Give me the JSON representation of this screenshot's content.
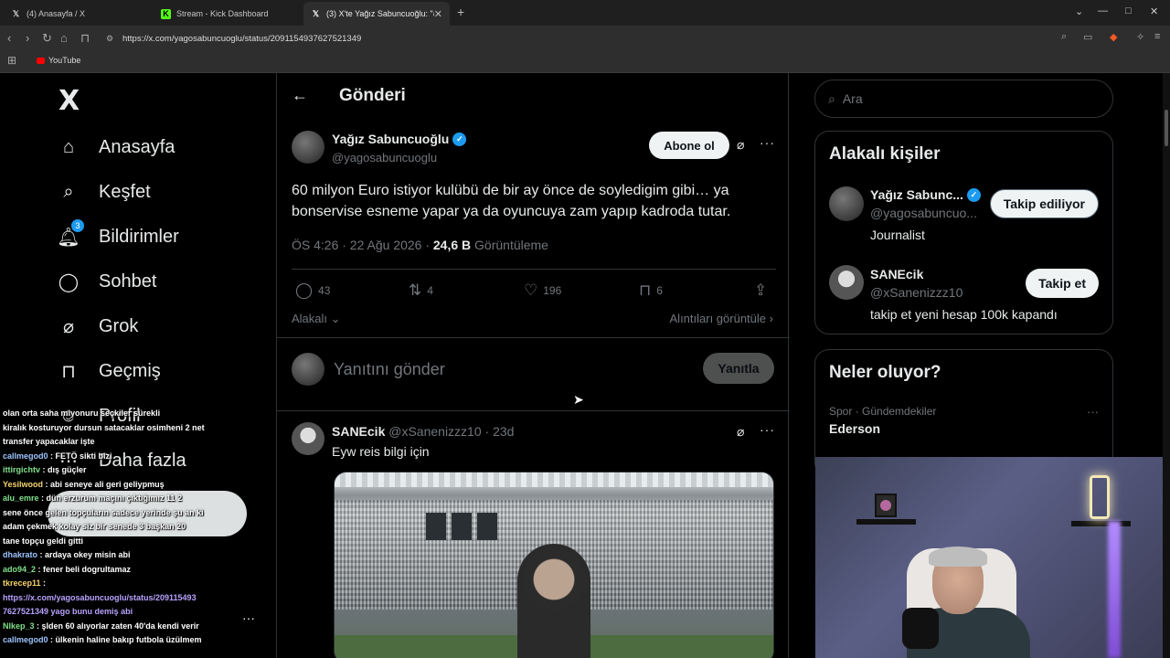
{
  "browser": {
    "tabs": [
      {
        "label": "(4) Anasayfa / X",
        "icon": "x-logo"
      },
      {
        "label": "Stream - Kick Dashboard",
        "icon": "kick-logo"
      },
      {
        "label": "(3) X'te Yağız Sabuncuoğlu: \"@x…",
        "icon": "x-logo"
      }
    ],
    "url": "https://x.com/yagosabuncuoglu/status/2091154937627521349",
    "bookmark": "YouTube"
  },
  "nav": {
    "logo": "X",
    "items": [
      {
        "label": "Anasayfa",
        "icon": "home-icon"
      },
      {
        "label": "Keşfet",
        "icon": "search-icon"
      },
      {
        "label": "Bildirimler",
        "icon": "bell-icon",
        "badge": "3"
      },
      {
        "label": "Sohbet",
        "icon": "chat-icon"
      },
      {
        "label": "Grok",
        "icon": "grok-icon"
      },
      {
        "label": "Geçmiş",
        "icon": "bookmark-icon"
      },
      {
        "label": "Profil",
        "icon": "profile-icon"
      },
      {
        "label": "Daha fazla",
        "icon": "more-icon"
      }
    ]
  },
  "header": {
    "title": "Gönderi"
  },
  "post": {
    "author": "Yağız Sabuncuoğlu",
    "handle": "@yagosabuncuoglu",
    "subscribe": "Abone ol",
    "text": "60 milyon Euro istiyor kulübü de bir ay önce de soyledigim gibi… ya bonservise esneme yapar ya da oyuncuya zam yapıp kadroda tutar.",
    "time": "ÖS 4:26 · 22 Ağu 2026 · ",
    "views": "24,6 B",
    "views_label": " Görüntüleme",
    "replies": "43",
    "reposts": "4",
    "likes": "196",
    "bookmarks": "6",
    "sort": "Alakalı",
    "quotes": "Alıntıları görüntüle"
  },
  "composer": {
    "placeholder": "Yanıtını gönder",
    "button": "Yanıtla"
  },
  "reply": {
    "name": "SANEcik",
    "handle": "@xSanenizzz10 · 23d",
    "text": "Eyw reis bilgi için"
  },
  "right": {
    "search_placeholder": "Ara",
    "people_title": "Alakalı kişiler",
    "people": [
      {
        "name": "Yağız Sabunc...",
        "handle": "@yagosabuncuo...",
        "bio": "Journalist",
        "button": "Takip ediliyor"
      },
      {
        "name": "SANEcik",
        "handle": "@xSanenizzz10",
        "bio": "takip et yeni hesap 100k kapandı",
        "button": "Takip et"
      }
    ],
    "trends_title": "Neler oluyor?",
    "trend": {
      "category": "Spor · Gündemdekiler",
      "name": "Ederson"
    }
  },
  "chat": [
    {
      "user": "",
      "text": "olan orta saha miyonuru seçkiler sürekli",
      "color": "#ffffff"
    },
    {
      "user": "",
      "text": "kiralık kosturuyor dursun satacaklar osimheni 2 net",
      "color": "#ffffff"
    },
    {
      "user": "",
      "text": "transfer yapacaklar işte",
      "color": "#ffffff"
    },
    {
      "user": "callmegod0",
      "text": " : FETÖ sikti bizi",
      "color": "#9ec5ff"
    },
    {
      "user": "ittirgichtv",
      "text": " : dış güçler",
      "color": "#7fe08a"
    },
    {
      "user": "Yesilwood",
      "text": " : abi seneye ali geri geliypmuş",
      "color": "#f5d36b"
    },
    {
      "user": "alu_emre",
      "text": " : dün erzurum maçını çıktığımız 11 2",
      "color": "#7fe08a"
    },
    {
      "user": "",
      "text": "sene önce gelen topçuların sadece yerinde şu an ki",
      "color": "#ffffff"
    },
    {
      "user": "",
      "text": "adam çekmek kolay siz bir senede 3 başkan 20",
      "color": "#ffffff"
    },
    {
      "user": "",
      "text": "tane topçu geldi gitti",
      "color": "#ffffff"
    },
    {
      "user": "dhakrato",
      "text": " : ardaya okey misin abi",
      "color": "#9ec5ff"
    },
    {
      "user": "ado94_2",
      "text": " : fener beli dogrultamaz",
      "color": "#7fe08a"
    },
    {
      "user": "tkrecep11",
      "text": " :",
      "color": "#f5d36b"
    },
    {
      "user": "",
      "text": "https://x.com/yagosabuncuoglu/status/209115493",
      "color": "#b9a3ff"
    },
    {
      "user": "",
      "text": "7627521349 yago bunu demiş abi",
      "color": "#b9a3ff"
    },
    {
      "user": "Nlkep_3",
      "text": " : şlden 60 alıyorlar zaten 40'da kendi verir",
      "color": "#7fe08a"
    },
    {
      "user": "callmegod0",
      "text": " : ülkenin haline bakıp futbola üzülmem",
      "color": "#9ec5ff"
    }
  ],
  "colors": {
    "accent": "#1d9bf0",
    "bg": "#000000",
    "border": "#2f3336",
    "muted": "#71767b"
  }
}
